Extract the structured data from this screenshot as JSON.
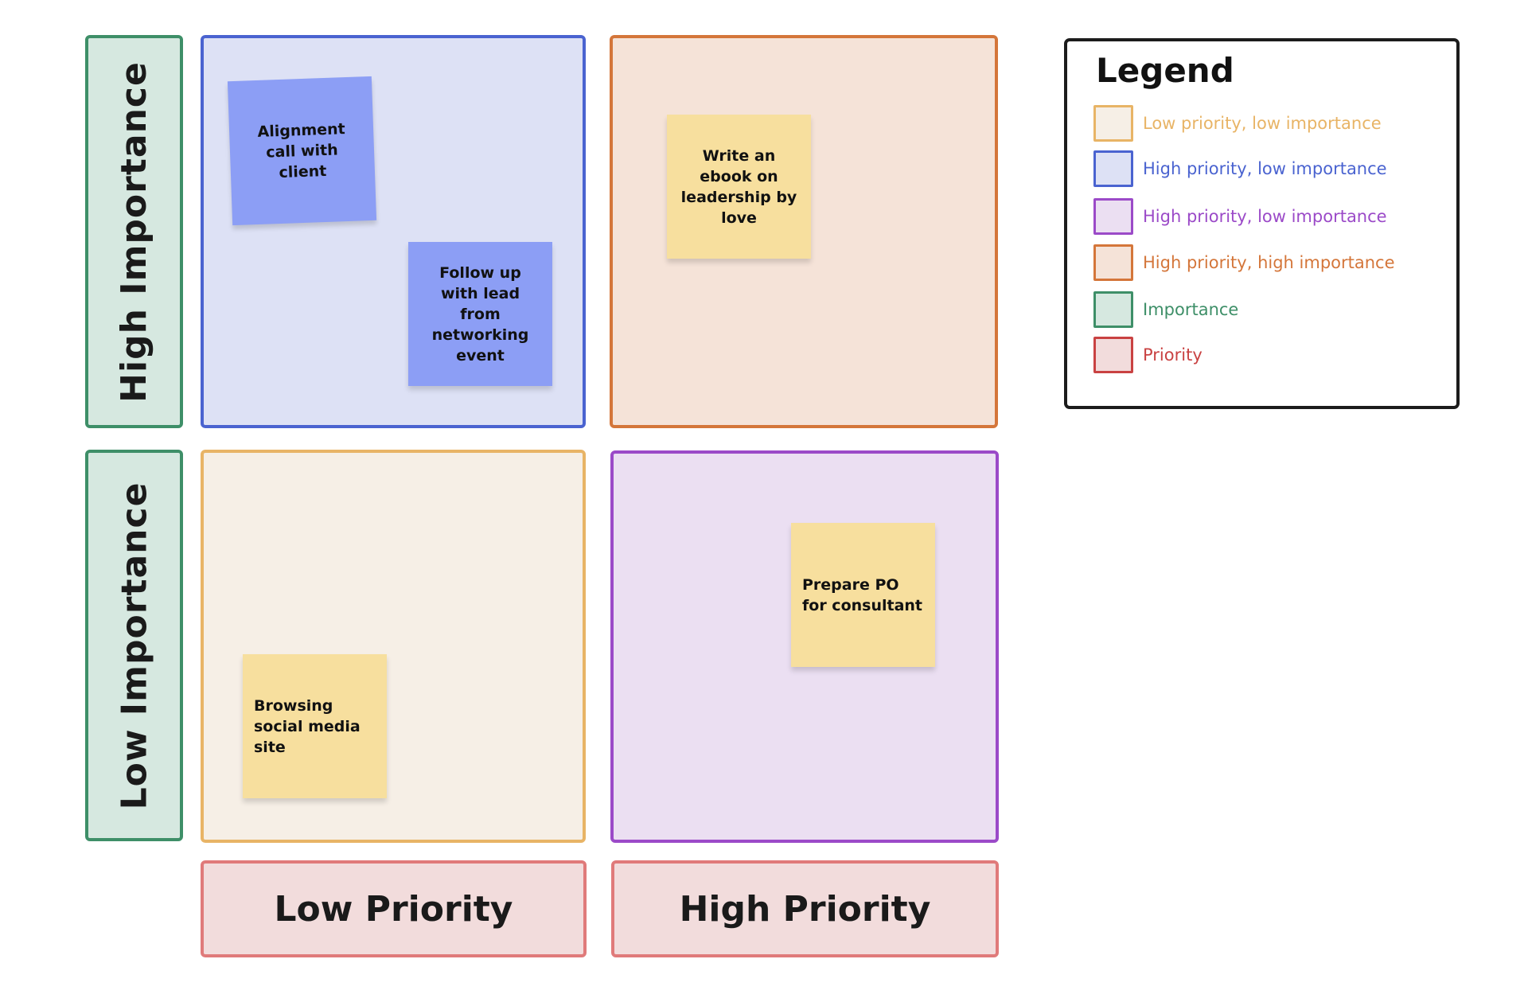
{
  "axes": {
    "high_importance": "High Importance",
    "low_importance": "Low Importance",
    "low_priority": "Low Priority",
    "high_priority": "High Priority"
  },
  "quadrants": {
    "high_importance_low_priority": {
      "notes": [
        "Alignment call with client",
        "Follow up with lead from networking event"
      ]
    },
    "high_importance_high_priority": {
      "notes": [
        "Write an ebook on leadership by love"
      ]
    },
    "low_importance_low_priority": {
      "notes": [
        "Browsing social media site"
      ]
    },
    "low_importance_high_priority": {
      "notes": [
        "Prepare PO for consultant"
      ]
    }
  },
  "legend": {
    "title": "Legend",
    "items": [
      {
        "label": "Low priority, low importance",
        "color": "#e8b466",
        "fill": "#f6efe6"
      },
      {
        "label": "High priority, low importance",
        "color": "#4a63d0",
        "fill": "#dde1f5"
      },
      {
        "label": "High priority, low importance",
        "color": "#9b4ac8",
        "fill": "#ebdff2"
      },
      {
        "label": "High priority, high importance",
        "color": "#d4763a",
        "fill": "#f5e3d8"
      },
      {
        "label": "Importance",
        "color": "#3e8f68",
        "fill": "#d6e8e0"
      },
      {
        "label": "Priority",
        "color": "#c94242",
        "fill": "#f2dcdc"
      }
    ]
  },
  "colors": {
    "sticky_blue": "#8c9ef5",
    "sticky_yellow": "#f7df9e"
  }
}
